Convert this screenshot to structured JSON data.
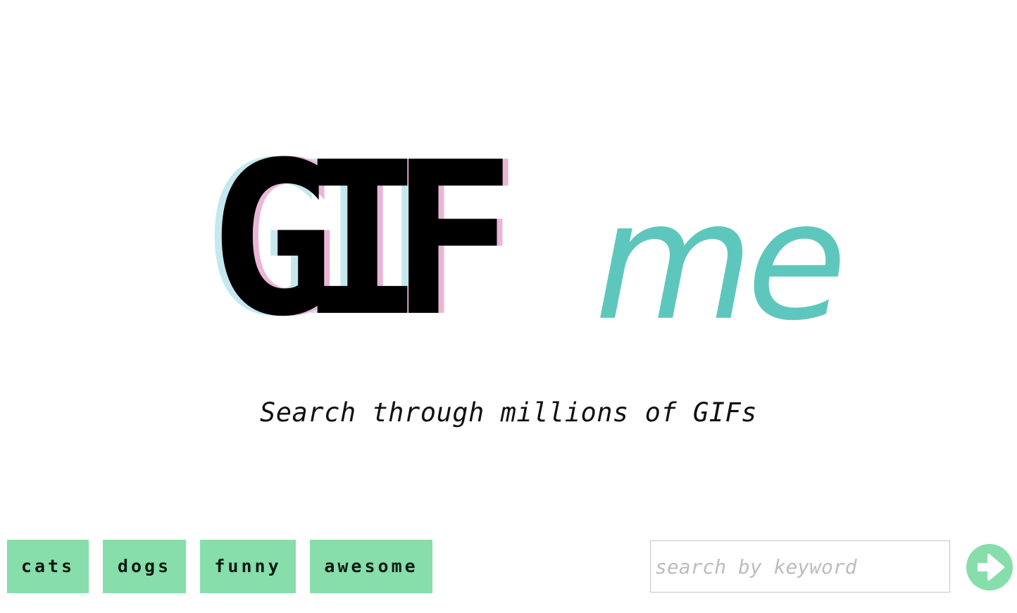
{
  "logo": {
    "gif_text": "GIF",
    "me_text": "me"
  },
  "tagline": "Search through millions of GIFs",
  "tags": [
    {
      "label": "cats"
    },
    {
      "label": "dogs"
    },
    {
      "label": "funny"
    },
    {
      "label": "awesome"
    }
  ],
  "search": {
    "placeholder": "search by keyword",
    "value": "",
    "submit_icon": "arrow-right-icon"
  },
  "colors": {
    "accent_green": "#87deab",
    "logo_teal": "#5ec7bd",
    "logo_cyan_shadow": "#c4e8ee",
    "logo_pink_shadow": "#e9b6d6",
    "text_black": "#000000"
  }
}
